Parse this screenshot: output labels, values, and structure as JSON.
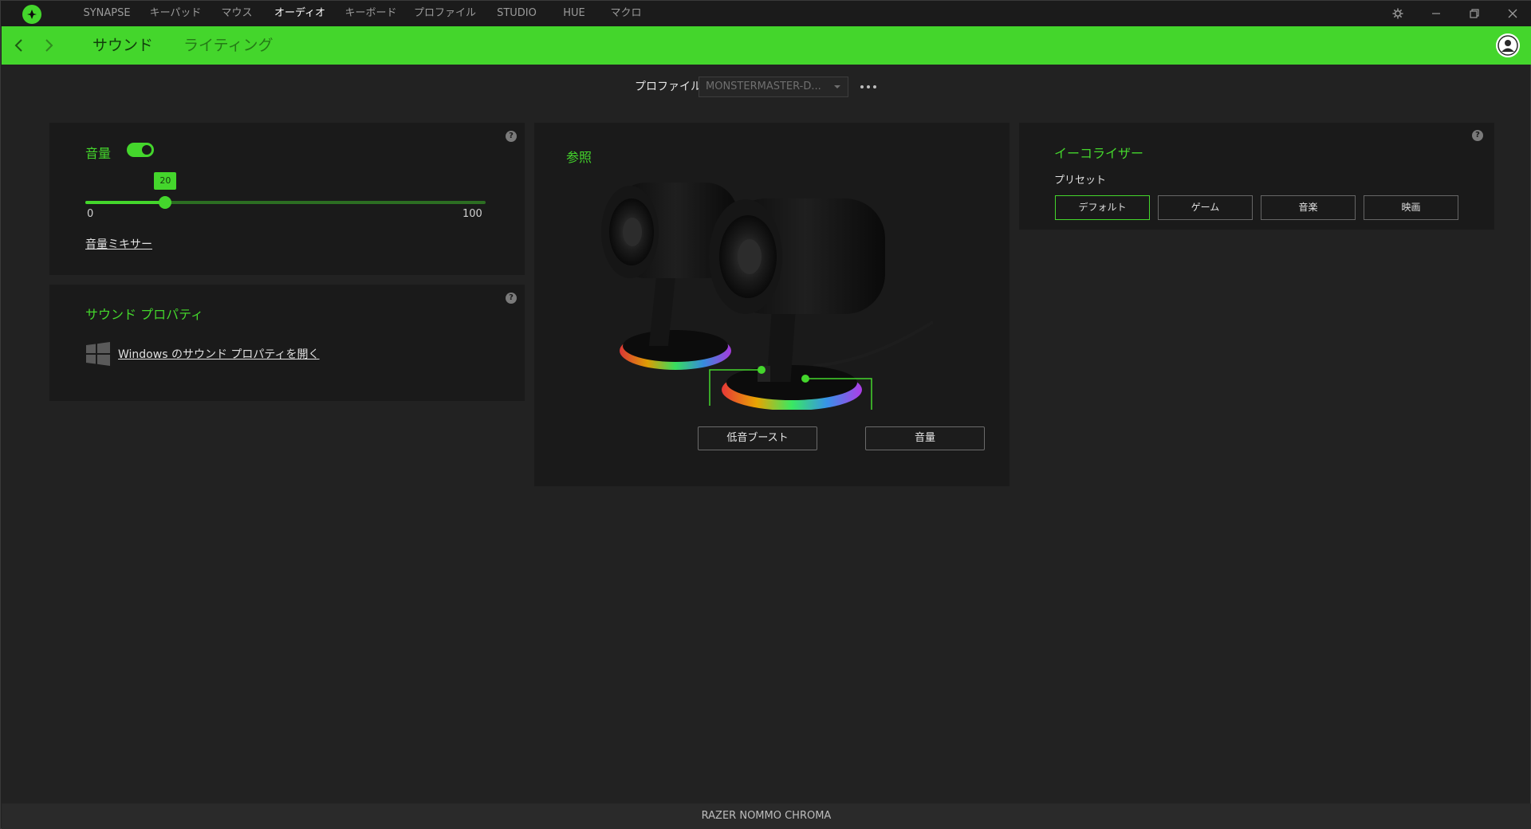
{
  "topbar": {
    "nav": [
      {
        "label": "SYNAPSE",
        "active": false
      },
      {
        "label": "キーパッド",
        "active": false
      },
      {
        "label": "マウス",
        "active": false
      },
      {
        "label": "オーディオ",
        "active": true
      },
      {
        "label": "キーボード",
        "active": false
      },
      {
        "label": "プロファイル",
        "active": false
      },
      {
        "label": "STUDIO",
        "active": false
      },
      {
        "label": "HUE",
        "active": false
      },
      {
        "label": "マクロ",
        "active": false
      }
    ]
  },
  "subbar": {
    "tabs": [
      {
        "label": "サウンド",
        "active": true
      },
      {
        "label": "ライティング",
        "active": false
      }
    ]
  },
  "profile": {
    "label": "プロファイル",
    "selected": "MONSTERMASTER-D..."
  },
  "volume_panel": {
    "title": "音量",
    "enabled": true,
    "value": "20",
    "min": "0",
    "max": "100",
    "mixer_link": "音量ミキサー"
  },
  "sound_props_panel": {
    "title": "サウンド プロパティ",
    "link": "Windows のサウンド プロパティを開く"
  },
  "reference_panel": {
    "title": "参照",
    "callouts": {
      "bass_boost": "低音ブースト",
      "volume": "音量"
    }
  },
  "eq_panel": {
    "title": "イーコライザー",
    "preset_label": "プリセット",
    "presets": [
      {
        "label": "デフォルト",
        "active": true
      },
      {
        "label": "ゲーム",
        "active": false
      },
      {
        "label": "音楽",
        "active": false
      },
      {
        "label": "映画",
        "active": false
      }
    ]
  },
  "footer": {
    "device_name": "RAZER NOMMO CHROMA"
  },
  "colors": {
    "accent": "#44d62c",
    "background": "#222222",
    "panel": "#1a1a1a"
  }
}
